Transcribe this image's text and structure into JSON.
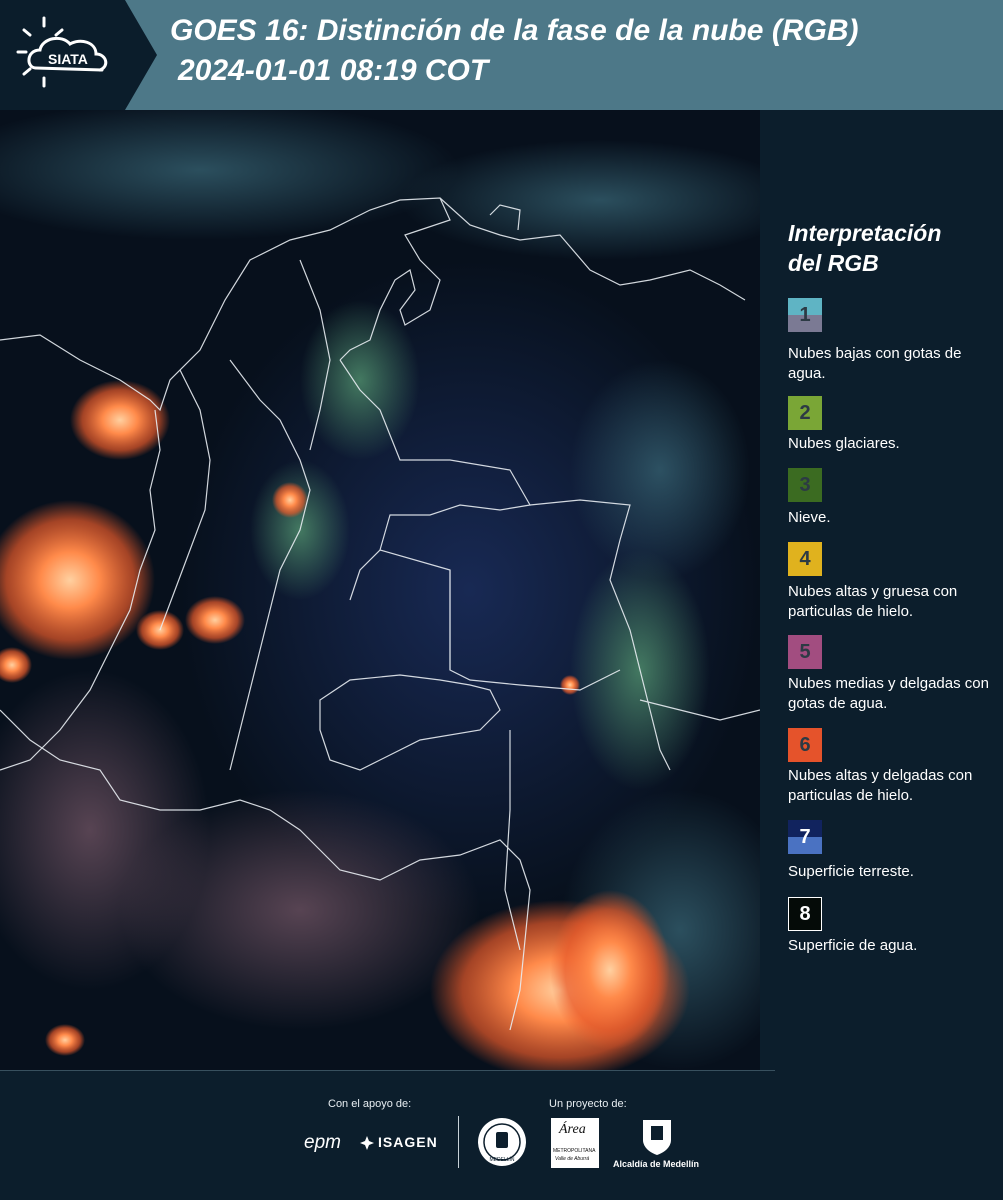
{
  "header": {
    "logo_text": "SIATA",
    "title_line1": "GOES 16: Distinción de la fase de la nube (RGB)",
    "title_line2": "2024-01-01 08:19 COT"
  },
  "legend": {
    "title_line1": "Interpretación",
    "title_line2": "del RGB",
    "items": [
      {
        "number": "1",
        "label": "Nubes bajas con gotas de agua.",
        "color_top": "#5fb4c4",
        "color_bottom": "#7b7a94"
      },
      {
        "number": "2",
        "label": "Nubes glaciares.",
        "color_top": "#7aa636",
        "color_bottom": "#7aa636"
      },
      {
        "number": "3",
        "label": "Nieve.",
        "color_top": "#3b6b21",
        "color_bottom": "#3b6b21"
      },
      {
        "number": "4",
        "label": "Nubes altas y gruesa con particulas de hielo.",
        "color_top": "#e0b21e",
        "color_bottom": "#e0b21e"
      },
      {
        "number": "5",
        "label": "Nubes medias y delgadas con gotas de agua.",
        "color_top": "#a24d80",
        "color_bottom": "#a24d80"
      },
      {
        "number": "6",
        "label": "Nubes altas y delgadas con particulas de hielo.",
        "color_top": "#e5532b",
        "color_bottom": "#e5532b"
      },
      {
        "number": "7",
        "label": "Superficie terreste.",
        "color_top": "#11235e",
        "color_bottom": "#4a72c2"
      },
      {
        "number": "8",
        "label": "Superficie de agua.",
        "color_top": "#050b08",
        "color_bottom": "#050b08"
      }
    ]
  },
  "footer": {
    "support_caption": "Con el apoyo de:",
    "project_caption": "Un proyecto de:",
    "sponsors": [
      "epm",
      "ISAGEN"
    ],
    "partners": {
      "area_name": "Área",
      "area_sub1": "METROPOLITANA",
      "area_sub2": "Valle de Aburrá",
      "alcaldia": "Alcaldía de Medellín",
      "seal_text": "MEDELLÍN"
    }
  },
  "colors": {
    "header_band": "#4d7888",
    "background": "#0c1e2c",
    "map_background": "#0a1426"
  }
}
